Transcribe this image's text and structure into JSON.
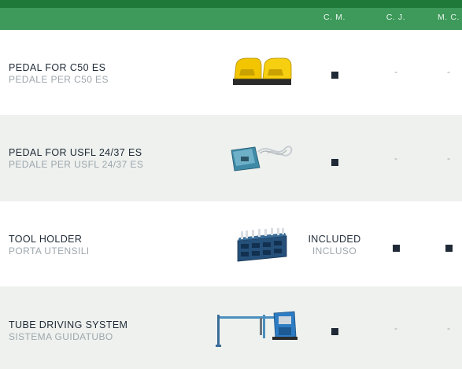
{
  "columns": {
    "cm": "C. M.",
    "cj": "C. J.",
    "mc": "M. C."
  },
  "rows": [
    {
      "name_en": "PEDAL FOR C50 ES",
      "name_it": "PEDALE PER C50 ES",
      "image": "yellow-double-foot-pedal",
      "cm": "■",
      "cj": "-",
      "mc": "-"
    },
    {
      "name_en": "PEDAL FOR USFL 24/37 ES",
      "name_it": "PEDALE PER USFL 24/37 ES",
      "image": "blue-foot-pedal-with-cable",
      "cm": "■",
      "cj": "-",
      "mc": "-"
    },
    {
      "name_en": "TOOL HOLDER",
      "name_it": "PORTA UTENSILI",
      "image": "tool-holder-tray",
      "cm_en": "INCLUDED",
      "cm_it": "INCLUSO",
      "cj": "■",
      "mc": "■"
    },
    {
      "name_en": "TUBE DRIVING SYSTEM",
      "name_it": "SISTEMA GUIDATUBO",
      "image": "tube-driving-system",
      "cm": "■",
      "cj": "-",
      "mc": "-"
    }
  ],
  "colors": {
    "header_dark": "#1f7a3a",
    "header": "#3d9a5a",
    "row_shade": "#eef1ee",
    "text_dark": "#1f2a36",
    "text_light": "#9ea7ad"
  }
}
